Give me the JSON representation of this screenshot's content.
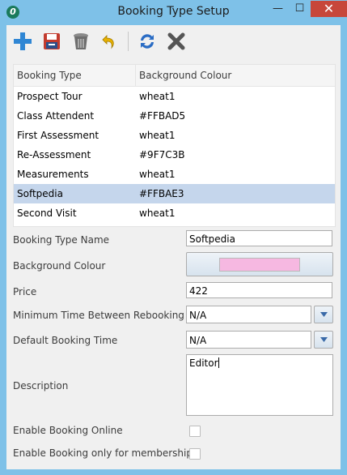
{
  "window": {
    "title": "Booking Type Setup",
    "app_icon_glyph": "0",
    "minimize_glyph": "—",
    "maximize_glyph": "☐",
    "close_glyph": "✕"
  },
  "toolbar": {
    "buttons": [
      {
        "icon": "add-icon",
        "color": "#2f86d4"
      },
      {
        "icon": "save-icon",
        "color": "#c33b2e"
      },
      {
        "icon": "delete-bin-icon",
        "color": "#6e6e6e"
      },
      {
        "icon": "undo-icon",
        "color": "#e8b100"
      },
      {
        "icon": "refresh-icon",
        "color": "#2a6cc4"
      },
      {
        "icon": "close-x-icon",
        "color": "#555555"
      }
    ]
  },
  "grid": {
    "columns": [
      "Booking Type",
      "Background Colour"
    ],
    "rows": [
      {
        "type": "Prospect Tour",
        "colour": "wheat1",
        "selected": false
      },
      {
        "type": "Class Attendent",
        "colour": "#FFBAD5",
        "selected": false
      },
      {
        "type": "First Assessment",
        "colour": "wheat1",
        "selected": false
      },
      {
        "type": "Re-Assessment",
        "colour": "#9F7C3B",
        "selected": false
      },
      {
        "type": "Measurements",
        "colour": "wheat1",
        "selected": false
      },
      {
        "type": "Softpedia",
        "colour": "#FFBAE3",
        "selected": true
      },
      {
        "type": "Second Visit",
        "colour": "wheat1",
        "selected": false
      }
    ]
  },
  "form": {
    "name_label": "Booking Type Name",
    "name_value": "Softpedia",
    "bg_label": "Background Colour",
    "bg_swatch": "#f6b8e1",
    "price_label": "Price",
    "price_value": "422",
    "min_time_label": "Minimum Time Between Rebooking",
    "min_time_value": "N/A",
    "default_time_label": "Default Booking Time",
    "default_time_value": "N/A",
    "description_label": "Description",
    "description_value": "Editor",
    "online_label": "Enable Booking Online",
    "membership_label": "Enable Booking only for membership"
  }
}
